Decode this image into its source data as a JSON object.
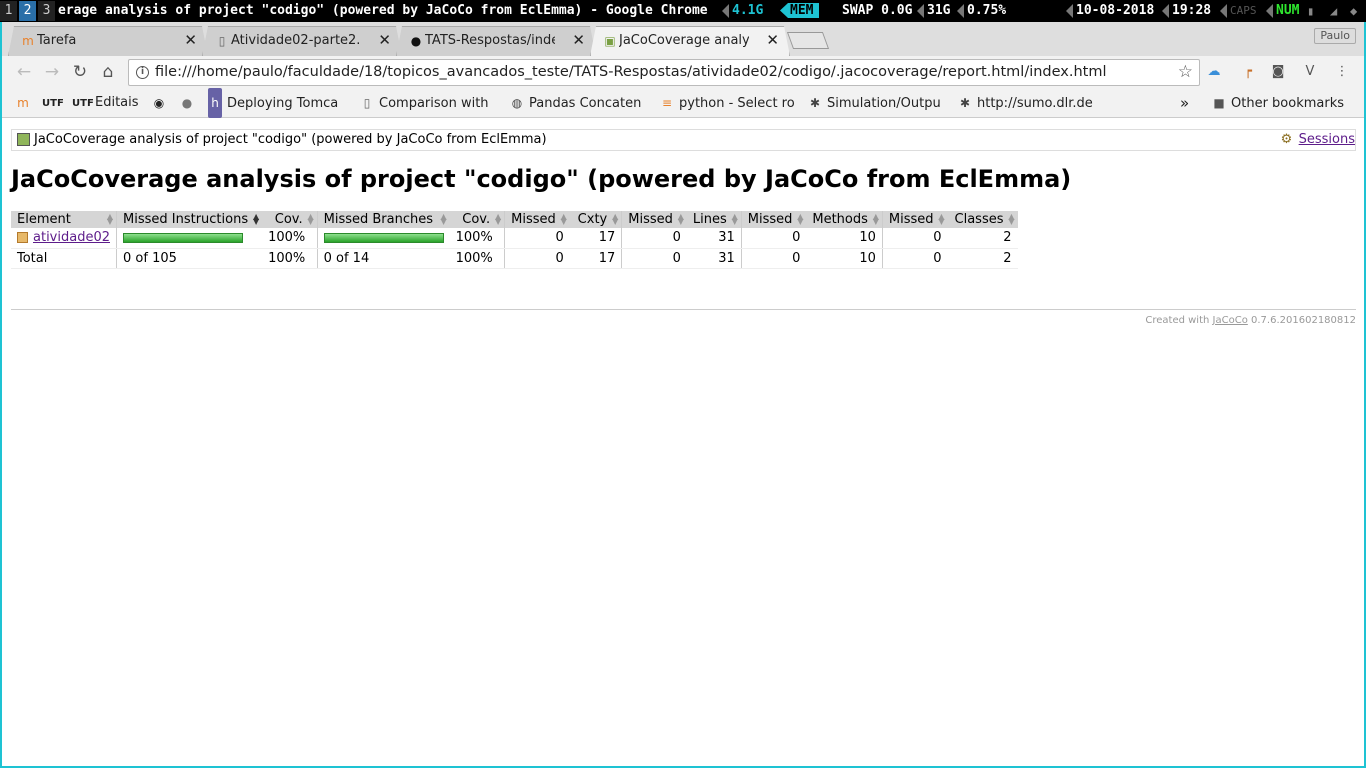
{
  "wm": {
    "workspaces": [
      "1",
      "2",
      "3"
    ],
    "active_workspace": "2",
    "window_title": "erage analysis of project \"codigo\" (powered by JaCoCo from EclEmma) - Google Chrome",
    "mem_used": "4.1G",
    "mem_label": "MEM",
    "swap": "SWAP 0.0G",
    "total_mem": "31G",
    "cpu": "0.75%",
    "date": "10-08-2018",
    "time": "19:28",
    "caps": "CAPS",
    "num": "NUM"
  },
  "tabs": [
    {
      "label": "Tarefa",
      "icon": "moodle-icon"
    },
    {
      "label": "Atividade02-parte2.p",
      "icon": "document-icon"
    },
    {
      "label": "TATS-Respostas/inde",
      "icon": "github-icon"
    },
    {
      "label": "JaCoCoverage analy",
      "icon": "report-icon"
    }
  ],
  "profile_name": "Paulo",
  "url": "file:///home/paulo/faculdade/18/topicos_avancados_teste/TATS-Respostas/atividade02/codigo/.jacocoverage/report.html/index.html",
  "bookmarks": [
    {
      "label": "",
      "icon": "moodle-icon"
    },
    {
      "label": "",
      "icon": "utf-icon"
    },
    {
      "label": "Editais",
      "icon": "utf-icon"
    },
    {
      "label": "",
      "icon": "video-icon"
    },
    {
      "label": "",
      "icon": "apple-icon"
    },
    {
      "label": "Deploying Tomca",
      "icon": "heroku-icon"
    },
    {
      "label": "Comparison with",
      "icon": "page-icon"
    },
    {
      "label": "Pandas Concaten",
      "icon": "pandas-icon"
    },
    {
      "label": "python - Select ro",
      "icon": "stackoverflow-icon"
    },
    {
      "label": "Simulation/Outpu",
      "icon": "sumo-icon"
    },
    {
      "label": "http://sumo.dlr.de",
      "icon": "sumo-icon"
    }
  ],
  "other_bookmarks": "Other bookmarks",
  "report": {
    "breadcrumb": "JaCoCoverage analysis of project \"codigo\" (powered by JaCoCo from EclEmma)",
    "sessions": "Sessions",
    "title": "JaCoCoverage analysis of project \"codigo\" (powered by JaCoCo from EclEmma)",
    "headers": [
      "Element",
      "Missed Instructions",
      "Cov.",
      "Missed Branches",
      "Cov.",
      "Missed",
      "Cxty",
      "Missed",
      "Lines",
      "Missed",
      "Methods",
      "Missed",
      "Classes"
    ],
    "row": {
      "element": "atividade02",
      "instr_cov": "100%",
      "branch_cov": "100%",
      "missed_cxty": "0",
      "cxty": "17",
      "missed_lines": "0",
      "lines": "31",
      "missed_methods": "0",
      "methods": "10",
      "missed_classes": "0",
      "classes": "2"
    },
    "total": {
      "element": "Total",
      "instr": "0 of 105",
      "instr_cov": "100%",
      "branch": "0 of 14",
      "branch_cov": "100%",
      "missed_cxty": "0",
      "cxty": "17",
      "missed_lines": "0",
      "lines": "31",
      "missed_methods": "0",
      "methods": "10",
      "missed_classes": "0",
      "classes": "2"
    },
    "instr_coverage_fraction": 1.0,
    "branch_coverage_fraction": 1.0,
    "footer_prefix": "Created with",
    "footer_link": "JaCoCo",
    "footer_version": "0.7.6.201602180812"
  }
}
